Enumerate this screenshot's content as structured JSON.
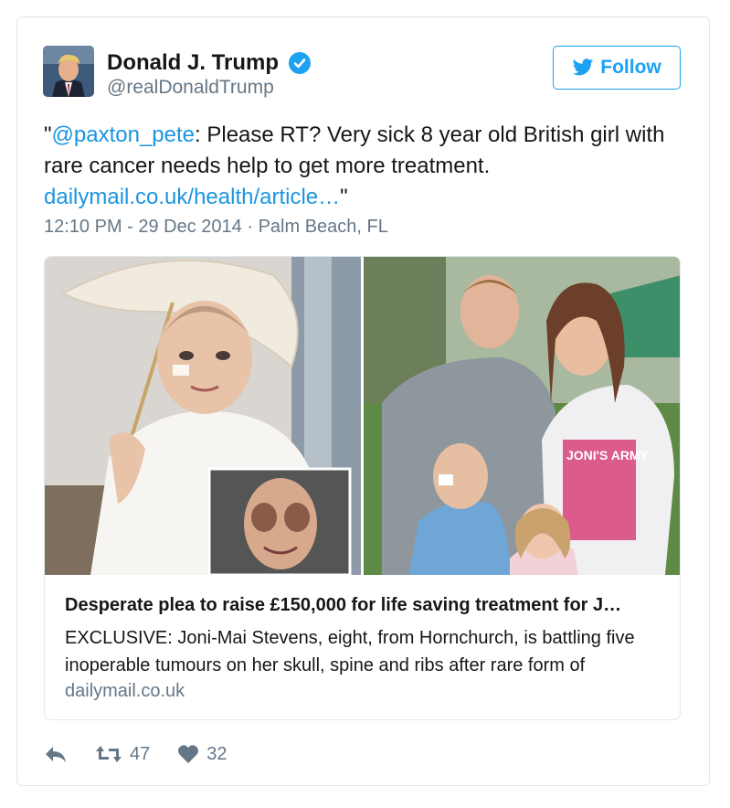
{
  "user": {
    "name": "Donald J. Trump",
    "handle": "@realDonaldTrump",
    "follow_label": "Follow"
  },
  "tweet": {
    "quote_open": "\"",
    "mention": "@paxton_pete",
    "text": ": Please RT? Very sick 8 year old British girl with rare cancer needs help to get more treatment.",
    "link": "dailymail.co.uk/health/article…",
    "quote_close": "\"",
    "timestamp": "12:10 PM - 29 Dec 2014 · Palm Beach, FL"
  },
  "card": {
    "title": "Desperate plea to raise £150,000 for life saving treatment for J…",
    "description": "EXCLUSIVE: Joni-Mai Stevens, eight, from Hornchurch, is battling five inoperable tumours on her skull, spine and ribs after rare form of",
    "domain": "dailymail.co.uk",
    "tshirt_text": "JONI'S ARMY"
  },
  "actions": {
    "retweets": "47",
    "likes": "32"
  },
  "colors": {
    "accent": "#1da1f2",
    "link": "#1b95e0",
    "muted": "#657786",
    "border": "#e1e8ed"
  }
}
